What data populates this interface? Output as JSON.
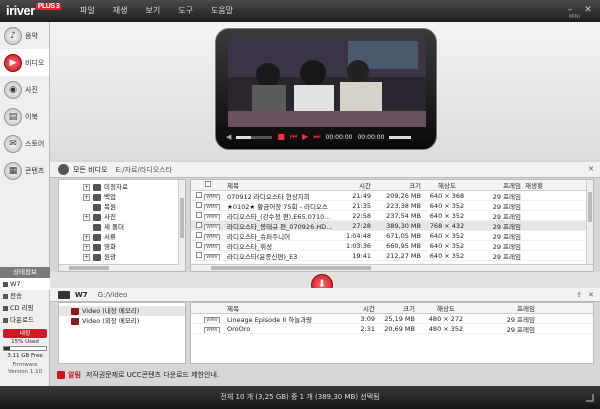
{
  "app": {
    "logo": "iriver",
    "logo_plus": "PLUS 3",
    "mini": "MINI"
  },
  "menu": [
    "파일",
    "재생",
    "보기",
    "도구",
    "도움말"
  ],
  "sidebar": {
    "items": [
      {
        "label": "음악",
        "icon": "music-note-icon"
      },
      {
        "label": "비디오",
        "icon": "video-icon"
      },
      {
        "label": "사진",
        "icon": "photo-icon"
      },
      {
        "label": "이북",
        "icon": "ebook-icon"
      },
      {
        "label": "스토어",
        "icon": "store-icon"
      },
      {
        "label": "콘텐츠",
        "icon": "contents-icon"
      }
    ],
    "status_header": "상태정보",
    "status_items": [
      "W7",
      "전송",
      "CD 리핑",
      "다운로드"
    ],
    "storage_label": "내장",
    "used_label": "15% Used",
    "used_fraction": 0.15,
    "free_label": "3.11 GB Free",
    "firmware_label": "Firmware",
    "firmware_version": "Version 1.10"
  },
  "player": {
    "current_time": "00:00:00",
    "total_time": "00:00:00",
    "progress_fraction": 0.4
  },
  "library": {
    "title": "모든 비디오",
    "path": "E:/자료/라디오스타",
    "tree": [
      {
        "label": "미정자료",
        "expand": "+"
      },
      {
        "label": "백업",
        "expand": "+"
      },
      {
        "label": "복원",
        "expand": ""
      },
      {
        "label": "사진",
        "expand": "+"
      },
      {
        "label": "새 폴더",
        "expand": ""
      },
      {
        "label": "서류",
        "expand": "+"
      },
      {
        "label": "영화",
        "expand": "+"
      },
      {
        "label": "원광",
        "expand": "+"
      }
    ],
    "columns": [
      "제목",
      "시간",
      "크기",
      "해상도",
      "프레임",
      "재생횟"
    ],
    "rows": [
      {
        "tag": "WMV",
        "title": "070912 라디오스타 현상지희",
        "time": "21:49",
        "size": "209,26 MB",
        "res": "640 × 368",
        "fps": "29 프레임"
      },
      {
        "tag": "WMV",
        "title": "★0102★ 황금어장 75회 - 라디오스",
        "time": "21:35",
        "size": "223,38 MB",
        "res": "640 × 352",
        "fps": "29 프레임"
      },
      {
        "tag": "WMV",
        "title": "라디오스타_(강수정 편),E65,0710...",
        "time": "22:58",
        "size": "237,54 MB",
        "res": "640 × 352",
        "fps": "29 프레임"
      },
      {
        "tag": "WMV",
        "title": "라디오스타_봉태규 편_070926.HD...",
        "time": "27:28",
        "size": "389,30 MB",
        "res": "768 × 432",
        "fps": "29 프레임"
      },
      {
        "tag": "WMV",
        "title": "라디오스타_슈퍼주니어",
        "time": "1:04:48",
        "size": "671,05 MB",
        "res": "640 × 352",
        "fps": "29 프레임"
      },
      {
        "tag": "WMV",
        "title": "라디오스타_휘성",
        "time": "1:03:36",
        "size": "660,95 MB",
        "res": "640 × 352",
        "fps": "29 프레임"
      },
      {
        "tag": "WMV",
        "title": "라디오스타(윤종신편)_E3",
        "time": "19:41",
        "size": "212,27 MB",
        "res": "640 × 352",
        "fps": "29 프레임"
      }
    ]
  },
  "device": {
    "name": "W7",
    "path": "G:/Video",
    "folders": [
      "Video (내장 메모리)",
      "Video (외장 메모리)"
    ],
    "columns": [
      "제목",
      "시간",
      "크기",
      "해상도",
      "프레임"
    ],
    "rows": [
      {
        "tag": "WMV",
        "title": "Lineage Episode II 하늘과땅",
        "time": "3:09",
        "size": "25,19 MB",
        "res": "480 × 272",
        "fps": "29 프레임"
      },
      {
        "tag": "WMV",
        "title": "OroOro",
        "time": "2:31",
        "size": "20,69 MB",
        "res": "480 × 352",
        "fps": "29 프레임"
      }
    ]
  },
  "notice": {
    "label": "알림",
    "text": "저작권문제로 UCC콘텐츠 다운로드 제한안내."
  },
  "statusbar": {
    "text": "전체 10 개 (3,25 GB) 중 1 개 (389,30 MB) 선택됨"
  },
  "colors": {
    "accent": "#d0161d",
    "chrome": "#1e1e1e"
  }
}
